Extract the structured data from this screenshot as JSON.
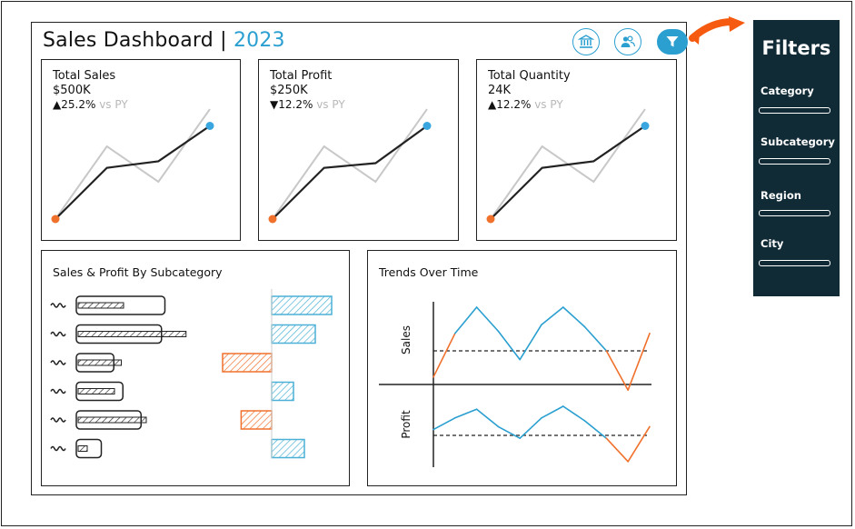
{
  "header": {
    "title": "Sales Dashboard",
    "separator": "|",
    "year": "2023",
    "buttons": [
      {
        "icon": "bank-icon"
      },
      {
        "icon": "users-icon"
      },
      {
        "icon": "filter-icon"
      }
    ]
  },
  "kpis": [
    {
      "title": "Total Sales",
      "value": "$500K",
      "arrow": "▲",
      "delta": "25.2%",
      "py_label": "vs PY",
      "spark_current": [
        0,
        55,
        62,
        100
      ],
      "spark_previous": [
        0,
        78,
        40,
        118
      ]
    },
    {
      "title": "Total Profit",
      "value": "$250K",
      "arrow": "▼",
      "delta": "12.2%",
      "py_label": "vs PY",
      "spark_current": [
        0,
        55,
        60,
        100
      ],
      "spark_previous": [
        0,
        78,
        40,
        118
      ]
    },
    {
      "title": "Total Quantity",
      "value": "24K",
      "arrow": "▲",
      "delta": "12.2%",
      "py_label": "vs PY",
      "spark_current": [
        0,
        55,
        62,
        100
      ],
      "spark_previous": [
        0,
        78,
        40,
        118
      ]
    }
  ],
  "subcategory_panel": {
    "title": "Sales & Profit By Subcategory",
    "rows": [
      {
        "sales": 0.78,
        "sales_py": 0.4,
        "profit": 0.55
      },
      {
        "sales": 0.75,
        "sales_py": 0.95,
        "profit": 0.4
      },
      {
        "sales": 0.33,
        "sales_py": 0.38,
        "profit": -0.45
      },
      {
        "sales": 0.41,
        "sales_py": 0.32,
        "profit": 0.2
      },
      {
        "sales": 0.57,
        "sales_py": 0.6,
        "profit": -0.28
      },
      {
        "sales": 0.22,
        "sales_py": 0.08,
        "profit": 0.3
      }
    ],
    "colors": {
      "positive": "#4ab0d6",
      "negative": "#f0712c"
    }
  },
  "trends_panel": {
    "title": "Trends Over Time",
    "charts": [
      {
        "label": "Sales",
        "values": [
          -0.6,
          0.4,
          1.0,
          0.45,
          -0.2,
          0.6,
          1.0,
          0.55,
          0.0,
          -0.9,
          0.4
        ]
      },
      {
        "label": "Profit",
        "values": [
          0.2,
          0.6,
          0.9,
          0.3,
          -0.1,
          0.6,
          1.0,
          0.5,
          -0.1,
          -0.9,
          0.3
        ]
      }
    ],
    "colors": {
      "up": "#2a9fd0",
      "down": "#f0712c"
    }
  },
  "filters": {
    "title": "Filters",
    "items": [
      {
        "label": "Category"
      },
      {
        "label": "Subcategory"
      },
      {
        "label": "Region"
      },
      {
        "label": "City"
      }
    ]
  },
  "colors": {
    "accent": "#2a9fd0",
    "panel": "#102a36",
    "arrow": "#f55a10",
    "start_dot": "#f0712c",
    "end_dot": "#3aa6e0"
  }
}
